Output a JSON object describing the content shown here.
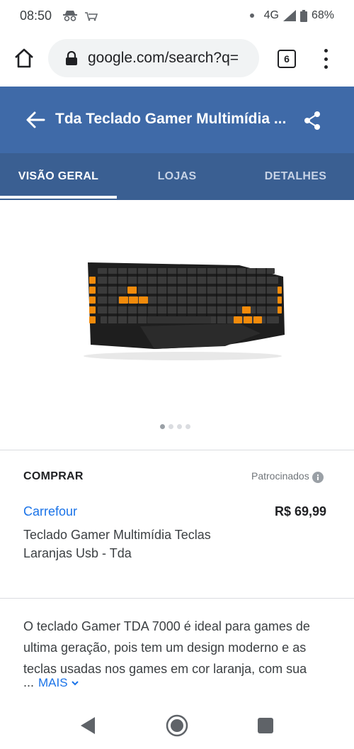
{
  "status_bar": {
    "time": "08:50",
    "network": "4G",
    "battery": "68%"
  },
  "browser": {
    "url": "google.com/search?q=",
    "tab_count": "6"
  },
  "header": {
    "title": "Tda Teclado Gamer Multimídia ..."
  },
  "tabs": [
    {
      "label": "VISÃO GERAL",
      "active": true
    },
    {
      "label": "LOJAS",
      "active": false
    },
    {
      "label": "DETALHES",
      "active": false
    }
  ],
  "carousel": {
    "total": 4,
    "current": 1
  },
  "buy": {
    "title": "COMPRAR",
    "sponsored_label": "Patrocinados",
    "store": "Carrefour",
    "price": "R$ 69,99",
    "product_line1": "Teclado Gamer Multimídia Teclas",
    "product_line2": "Laranjas Usb - Tda"
  },
  "description": {
    "text": "O teclado Gamer TDA 7000 é ideal para games de ultima geração, pois tem um design moderno e as teclas usadas nos games em cor laranja, com sua",
    "ellipsis": "...",
    "more_label": "MAIS"
  },
  "colors": {
    "header_bg": "#3f6aa8",
    "tab_bg": "#3a5f92",
    "link": "#1a73e8",
    "key_accent": "#f28b0c"
  }
}
